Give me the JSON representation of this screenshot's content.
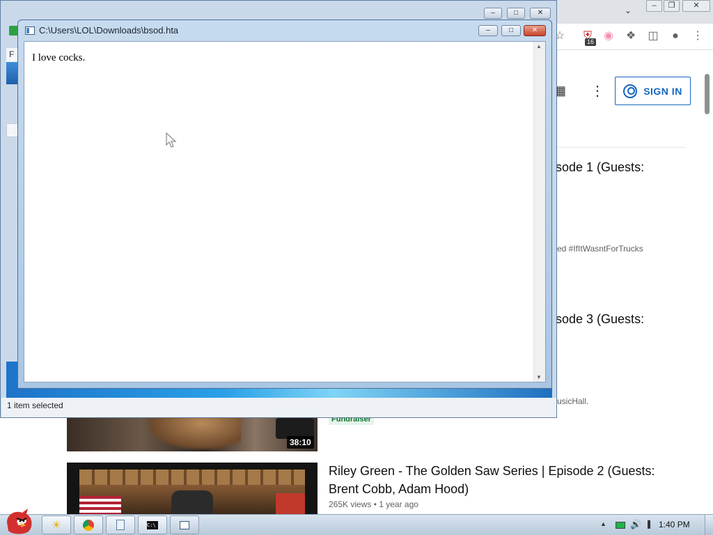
{
  "youtube": {
    "sign_in_label": "SIGN IN",
    "extension_badge": "16",
    "videos": [
      {
        "title_partial": "sode 1 (Guests:",
        "desc_partial": "ed #IfItWasntForTrucks"
      },
      {
        "title_partial": "sode 3 (Guests:",
        "desc_partial": "usicHall.",
        "badge": "Fundraiser",
        "duration": "38:10"
      },
      {
        "title_line1": "Riley Green - The Golden Saw Series | Episode 2 (Guests:",
        "title_line2": "Brent Cobb, Adam Hood)",
        "meta": "265K views • 1 year ago"
      }
    ]
  },
  "explorer": {
    "status": "1 item selected",
    "side_letter": "F"
  },
  "hta": {
    "title": "C:\\Users\\LOL\\Downloads\\bsod.hta",
    "body_text": "I love cocks."
  },
  "taskbar": {
    "clock": "1:40 PM",
    "apps": [
      "explorer",
      "chrome",
      "notepad",
      "cmd",
      "hta"
    ]
  },
  "colors": {
    "signin_blue": "#1565c0",
    "taskbar": "#c9d7e5",
    "titlebar": "#b8d0ea"
  }
}
